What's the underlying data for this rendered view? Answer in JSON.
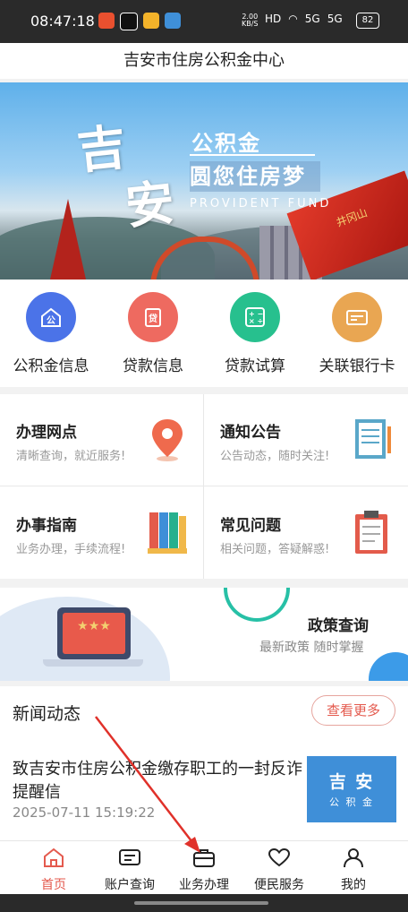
{
  "status": {
    "time": "08:47:18",
    "net_speed": "2.00",
    "net_unit": "KB/S",
    "signal1": "5G",
    "signal2": "5G",
    "battery": "82"
  },
  "title": "吉安市住房公积金中心",
  "banner": {
    "big1": "吉",
    "big2": "安",
    "line1": "公积金",
    "line2": "圆您住房梦",
    "line3": "PROVIDENT FUND",
    "flag_text": "井冈山"
  },
  "quick": [
    {
      "label": "公积金信息",
      "color": "#4b73e8",
      "icon": "house-icon"
    },
    {
      "label": "贷款信息",
      "color": "#ee6a60",
      "icon": "loan-icon"
    },
    {
      "label": "贷款试算",
      "color": "#27c08e",
      "icon": "calculator-icon"
    },
    {
      "label": "关联银行卡",
      "color": "#e9a652",
      "icon": "bank-card-icon"
    }
  ],
  "cells": [
    {
      "title": "办理网点",
      "sub": "清晰查询，就近服务!"
    },
    {
      "title": "通知公告",
      "sub": "公告动态，随时关注!"
    },
    {
      "title": "办事指南",
      "sub": "业务办理，手续流程!"
    },
    {
      "title": "常见问题",
      "sub": "相关问题，答疑解惑!"
    }
  ],
  "policy": {
    "title": "政策查询",
    "sub": "最新政策  随时掌握",
    "screen_text": "★★★"
  },
  "news": {
    "heading": "新闻动态",
    "more": "查看更多",
    "item_title": "致吉安市住房公积金缴存职工的一封反诈提醒信",
    "item_date": "2025-07-11 15:19:22",
    "thumb_a": "吉 安",
    "thumb_b": "公 积 金"
  },
  "tabs": [
    {
      "label": "首页",
      "active": true
    },
    {
      "label": "账户查询"
    },
    {
      "label": "业务办理"
    },
    {
      "label": "便民服务"
    },
    {
      "label": "我的"
    }
  ],
  "colors": {
    "accent": "#e45a4e",
    "annotation": "#e0312a"
  }
}
